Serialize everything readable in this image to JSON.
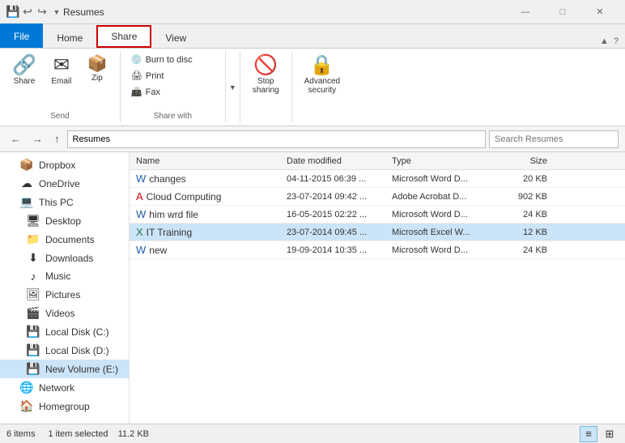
{
  "titleBar": {
    "title": "Resumes",
    "quickAccess": [
      "save",
      "undo",
      "redo"
    ],
    "windowControls": [
      "minimize",
      "maximize",
      "close"
    ]
  },
  "tabs": [
    {
      "id": "file",
      "label": "File"
    },
    {
      "id": "home",
      "label": "Home"
    },
    {
      "id": "share",
      "label": "Share",
      "active": true
    },
    {
      "id": "view",
      "label": "View"
    }
  ],
  "ribbon": {
    "groups": [
      {
        "id": "send",
        "label": "Send",
        "items": [
          {
            "id": "share",
            "label": "Share",
            "icon": "🔗"
          },
          {
            "id": "email",
            "label": "Email",
            "icon": "✉"
          },
          {
            "id": "zip",
            "label": "Zip",
            "icon": "🗜"
          }
        ]
      },
      {
        "id": "share-with",
        "label": "Share with",
        "items": [
          {
            "id": "burn-to-disc",
            "label": "Burn to disc"
          },
          {
            "id": "print",
            "label": "Print"
          },
          {
            "id": "fax",
            "label": "Fax"
          }
        ]
      },
      {
        "id": "stop-sharing",
        "label": "Stop sharing",
        "icon": "🚫"
      },
      {
        "id": "advanced-security",
        "label": "Advanced security",
        "icon": "🔒"
      }
    ]
  },
  "sidebar": {
    "items": [
      {
        "id": "dropbox",
        "label": "Dropbox",
        "icon": "📦",
        "indent": 1
      },
      {
        "id": "onedrive",
        "label": "OneDrive",
        "icon": "☁",
        "indent": 1
      },
      {
        "id": "this-pc",
        "label": "This PC",
        "icon": "💻",
        "indent": 1
      },
      {
        "id": "desktop",
        "label": "Desktop",
        "icon": "🖥",
        "indent": 2
      },
      {
        "id": "documents",
        "label": "Documents",
        "icon": "📁",
        "indent": 2
      },
      {
        "id": "downloads",
        "label": "Downloads",
        "icon": "⬇",
        "indent": 2
      },
      {
        "id": "music",
        "label": "Music",
        "icon": "♪",
        "indent": 2
      },
      {
        "id": "pictures",
        "label": "Pictures",
        "icon": "🖼",
        "indent": 2
      },
      {
        "id": "videos",
        "label": "Videos",
        "icon": "🎬",
        "indent": 2
      },
      {
        "id": "local-disk-c",
        "label": "Local Disk (C:)",
        "icon": "💾",
        "indent": 2
      },
      {
        "id": "local-disk-d",
        "label": "Local Disk (D:)",
        "icon": "💾",
        "indent": 2
      },
      {
        "id": "new-volume-e",
        "label": "New Volume (E:)",
        "icon": "💾",
        "indent": 2,
        "active": true
      },
      {
        "id": "network",
        "label": "Network",
        "icon": "🌐",
        "indent": 1
      },
      {
        "id": "homegroup",
        "label": "Homegroup",
        "icon": "🏠",
        "indent": 1
      }
    ]
  },
  "fileList": {
    "columns": [
      "Name",
      "Date modified",
      "Type",
      "Size"
    ],
    "files": [
      {
        "id": "changes",
        "name": "changes",
        "date": "04-11-2015 06:39 ...",
        "type": "Microsoft Word D...",
        "size": "20 KB",
        "icon": "word"
      },
      {
        "id": "cloud-computing",
        "name": "Cloud Computing",
        "date": "23-07-2014 09:42 ...",
        "type": "Adobe Acrobat D...",
        "size": "902 KB",
        "icon": "pdf"
      },
      {
        "id": "him-wrd-file",
        "name": "him wrd file",
        "date": "16-05-2015 02:22 ...",
        "type": "Microsoft Word D...",
        "size": "24 KB",
        "icon": "word"
      },
      {
        "id": "it-training",
        "name": "IT Training",
        "date": "23-07-2014 09:45 ...",
        "type": "Microsoft Excel W...",
        "size": "12 KB",
        "icon": "excel",
        "selected": true
      },
      {
        "id": "new",
        "name": "new",
        "date": "19-09-2014 10:35 ...",
        "type": "Microsoft Word D...",
        "size": "24 KB",
        "icon": "word"
      }
    ]
  },
  "statusBar": {
    "itemCount": "6 items",
    "selected": "1 item selected",
    "size": "11.2 KB"
  },
  "addressBar": {
    "path": "Resumes",
    "searchPlaceholder": "Search Resumes"
  }
}
